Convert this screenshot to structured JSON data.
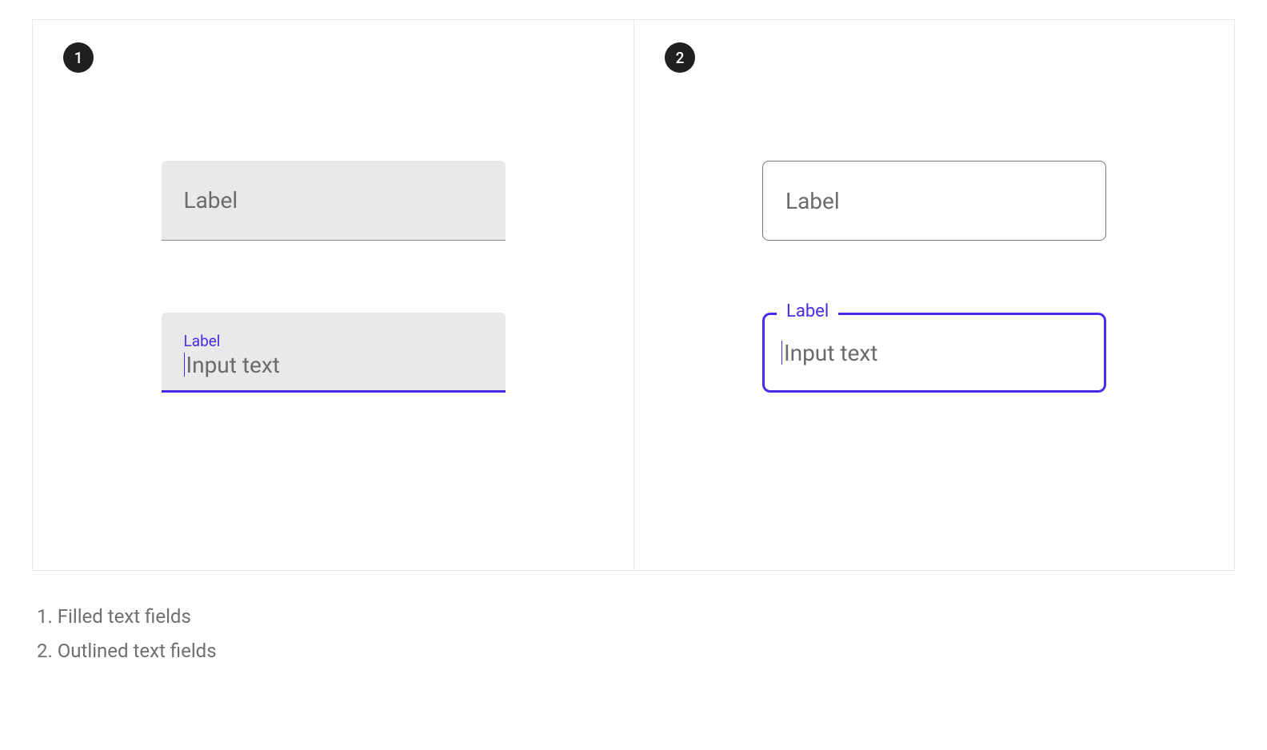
{
  "badges": {
    "left": "1",
    "right": "2"
  },
  "filled": {
    "idle_label": "Label",
    "focused_label": "Label",
    "focused_value": "Input text"
  },
  "outlined": {
    "idle_label": "Label",
    "focused_label": "Label",
    "focused_value": "Input text"
  },
  "captions": [
    "1. Filled text fields",
    "2. Outlined text fields"
  ],
  "colors": {
    "primary": "#4a2be5",
    "filled_bg": "#e9e9e9",
    "badge_bg": "#202020"
  }
}
